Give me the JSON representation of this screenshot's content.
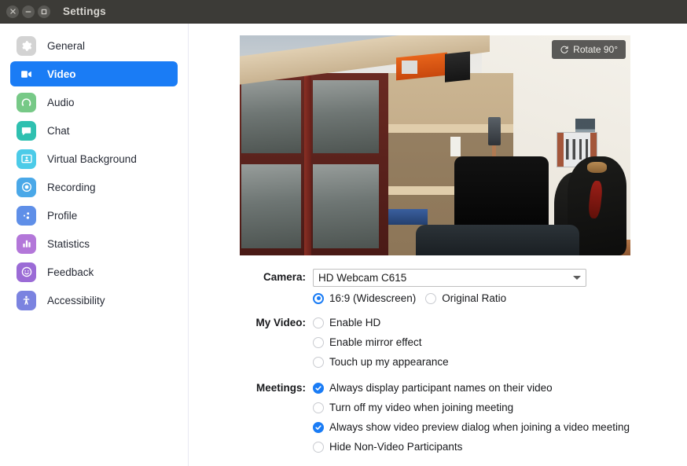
{
  "window": {
    "title": "Settings",
    "controls": [
      {
        "name": "close",
        "glyph": "×"
      },
      {
        "name": "minimize",
        "glyph": "−"
      },
      {
        "name": "maximize",
        "glyph": "□"
      }
    ]
  },
  "colors": {
    "accent": "#1a7cf5",
    "titlebar": "#3c3b37",
    "titlebar_text": "#d8d6d1",
    "text": "#18191c",
    "sidebar_divider": "#e9e9f2"
  },
  "sidebar": {
    "items": [
      {
        "label": "General",
        "icon": "gear-icon",
        "color": "#d3d3d3",
        "active": false
      },
      {
        "label": "Video",
        "icon": "video-camera-icon",
        "color": "#1a7cf5",
        "active": true
      },
      {
        "label": "Audio",
        "icon": "headphones-icon",
        "color": "#77c987",
        "active": false
      },
      {
        "label": "Chat",
        "icon": "chat-bubble-icon",
        "color": "#2fc0b0",
        "active": false
      },
      {
        "label": "Virtual Background",
        "icon": "person-frame-icon",
        "color": "#4ccbe8",
        "active": false
      },
      {
        "label": "Recording",
        "icon": "record-circle-icon",
        "color": "#4aa8e8",
        "active": false
      },
      {
        "label": "Profile",
        "icon": "profile-dots-icon",
        "color": "#5f8fe8",
        "active": false
      },
      {
        "label": "Statistics",
        "icon": "bar-chart-icon",
        "color": "#b377d9",
        "active": false
      },
      {
        "label": "Feedback",
        "icon": "smiley-face-icon",
        "color": "#9b6bd6",
        "active": false
      },
      {
        "label": "Accessibility",
        "icon": "accessibility-person-icon",
        "color": "#7b83e0",
        "active": false
      }
    ]
  },
  "preview": {
    "rotate_button_label": "Rotate 90°",
    "rotate_icon": "rotate-arrow-icon"
  },
  "form": {
    "camera": {
      "label": "Camera:",
      "selected": "HD Webcam C615",
      "options": [
        "HD Webcam C615"
      ],
      "ratio": [
        {
          "label": "16:9 (Widescreen)",
          "selected": true
        },
        {
          "label": "Original Ratio",
          "selected": false
        }
      ]
    },
    "my_video": {
      "label": "My Video:",
      "items": [
        {
          "label": "Enable HD",
          "checked": false
        },
        {
          "label": "Enable mirror effect",
          "checked": false
        },
        {
          "label": "Touch up my appearance",
          "checked": false
        }
      ]
    },
    "meetings": {
      "label": "Meetings:",
      "items": [
        {
          "label": "Always display participant names on their video",
          "checked": true
        },
        {
          "label": "Turn off my video when joining meeting",
          "checked": false
        },
        {
          "label": "Always show video preview dialog when joining a video meeting",
          "checked": true
        },
        {
          "label": "Hide Non-Video Participants",
          "checked": false
        }
      ]
    }
  }
}
